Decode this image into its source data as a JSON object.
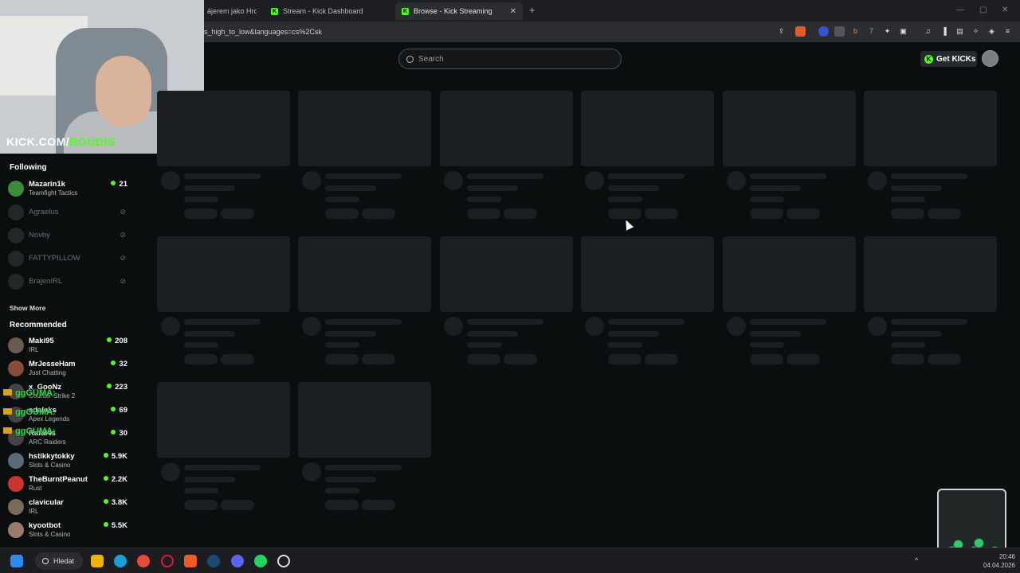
{
  "browser": {
    "tabs": [
      {
        "label": "ájerem jako Hrou:",
        "active": false
      },
      {
        "label": "Stream - Kick Dashboard",
        "active": false
      },
      {
        "label": "Browse - Kick Streaming",
        "active": true
      }
    ],
    "new_tab": "+",
    "url": "s_high_to_low&languages=cs%2Csk"
  },
  "header": {
    "search_placeholder": "Search",
    "get_kicks_label": "Get KICKs"
  },
  "webcam": {
    "brand_prefix": "KICK.COM/",
    "brand_suffix": "BOUDIS"
  },
  "sidebar": {
    "following_title": "Following",
    "following": [
      {
        "name": "Mazarin1k",
        "category": "Teamfight Tactics",
        "viewers": "21",
        "online": true
      },
      {
        "name": "Agraelus",
        "online": false
      },
      {
        "name": "Novby",
        "online": false
      },
      {
        "name": "FATTYPILLOW",
        "online": false
      },
      {
        "name": "BrajenIRL",
        "online": false
      }
    ],
    "show_more": "Show More",
    "recommended_title": "Recommended",
    "recommended": [
      {
        "name": "Maki95",
        "category": "IRL",
        "viewers": "208"
      },
      {
        "name": "MrJesseHam",
        "category": "Just Chatting",
        "viewers": "32"
      },
      {
        "name": "x_GooNz",
        "category": "Counter-Strike 2",
        "viewers": "223"
      },
      {
        "name": "adalaks",
        "category": "Apex Legends",
        "viewers": "69"
      },
      {
        "name": "Rafal4s",
        "category": "ARC Raiders",
        "viewers": "30"
      },
      {
        "name": "hstikkytokky",
        "category": "Slots & Casino",
        "viewers": "5.9K"
      },
      {
        "name": "TheBurntPeanut",
        "category": "Rust",
        "viewers": "2.2K"
      },
      {
        "name": "clavicular",
        "category": "IRL",
        "viewers": "3.8K"
      },
      {
        "name": "kyootbot",
        "category": "Slots & Casino",
        "viewers": "5.5K"
      }
    ],
    "overlay_names": [
      "ggGUMA:",
      "ggGUMA:",
      "ggGUMA:"
    ]
  },
  "taskbar": {
    "search_label": "Hledat",
    "time": "20:46",
    "date": "04.04.2026"
  }
}
